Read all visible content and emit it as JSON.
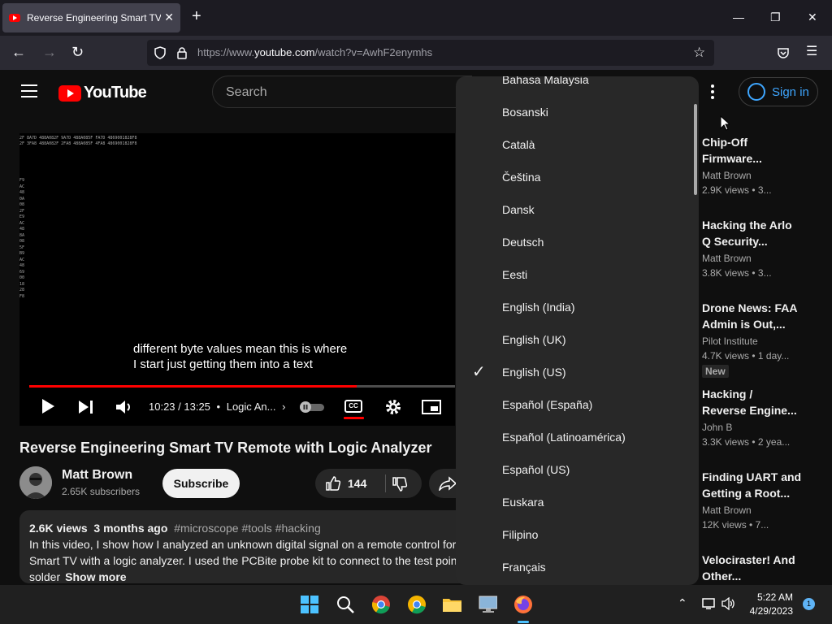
{
  "browser": {
    "tab_title": "Reverse Engineering Smart TV Remote with Logic Analyzer - YouTube",
    "url_prefix": "https://www.",
    "url_domain": "youtube.com",
    "url_path": "/watch?v=AwhF2enymhs"
  },
  "masthead": {
    "logo_text": "YouTube",
    "search_placeholder": "Search",
    "signin_label": "Sign in"
  },
  "video": {
    "hex_line_1": "2F 8A7D 488A082F 9A7D 488A085F FA7D 4869001828F8",
    "hex_line_2": "2F 3FA8 488A082F 2FA8 488A085F 4FA8 4869001828F8",
    "hex_column": "F9 AC 48 0A 08 2F E9 AC 48 8A 08 5F B9 AC 48 69 00 18 28 F8",
    "caption_line_1": "different byte values mean this is where",
    "caption_line_2": "I start just getting them into a text",
    "time": "10:23 / 13:25",
    "chapter": "Logic An...",
    "progress_percent": 77,
    "cc_label": "CC",
    "title": "Reverse Engineering Smart TV Remote with Logic Analyzer"
  },
  "channel": {
    "name": "Matt Brown",
    "subscribers": "2.65K subscribers",
    "subscribe_label": "Subscribe",
    "likes": "144"
  },
  "description": {
    "views": "2.6K views",
    "date": "3 months ago",
    "tags": "#microscope #tools #hacking",
    "line_1": "In this video, I show how I analyzed an unknown digital signal on a remote control for",
    "line_2": "Smart TV with a logic analyzer. I used the PCBite probe kit to connect to the test poin",
    "line_3": "solder",
    "show_more": "Show more"
  },
  "language_menu": {
    "selected": "English (US)",
    "items": [
      "Bahasa Malaysia",
      "Bosanski",
      "Català",
      "Čeština",
      "Dansk",
      "Deutsch",
      "Eesti",
      "English (India)",
      "English (UK)",
      "English (US)",
      "Español (España)",
      "Español (Latinoamérica)",
      "Español (US)",
      "Euskara",
      "Filipino",
      "Français"
    ]
  },
  "recommendations": [
    {
      "title_1": "Chip-Off",
      "title_2": "Firmware...",
      "channel": "Matt Brown",
      "meta": "2.9K views  •  3..."
    },
    {
      "title_1": "Hacking the Arlo",
      "title_2": "Q Security...",
      "channel": "Matt Brown",
      "meta": "3.8K views  •  3..."
    },
    {
      "title_1": "Drone News: FAA",
      "title_2": "Admin is Out,...",
      "channel": "Pilot Institute",
      "meta": "4.7K views  •  1 day...",
      "badge": "New"
    },
    {
      "title_1": "Hacking /",
      "title_2": "Reverse Engine...",
      "channel": "John B",
      "meta": "3.3K views  •  2 yea..."
    },
    {
      "title_1": "Finding UART and",
      "title_2": "Getting a Root...",
      "channel": "Matt Brown",
      "meta": "12K views  •  7..."
    },
    {
      "title_1": "Velociraster! And",
      "title_2": "Other..."
    }
  ],
  "taskbar": {
    "time": "5:22 AM",
    "date": "4/29/2023",
    "notifications": "1"
  },
  "colors": {
    "brand_red": "#ff0000",
    "link_blue": "#3ea6ff",
    "background": "#0f0f0f"
  }
}
